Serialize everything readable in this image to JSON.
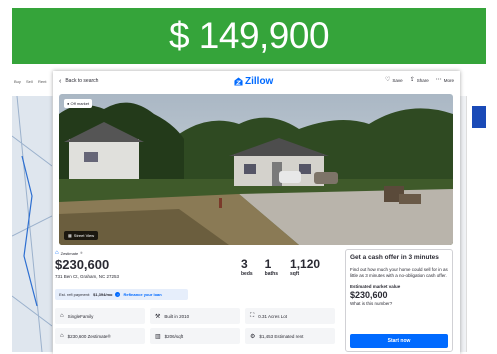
{
  "banner": {
    "price_text": "$ 149,900"
  },
  "colors": {
    "banner_green": "#35a43a",
    "zillow_blue": "#006aff",
    "text_dark": "#2a2a33"
  },
  "topbar": {
    "back_label": "Back to search",
    "logo_text": "Zillow",
    "actions": [
      {
        "label": "Save",
        "icon": "heart-icon"
      },
      {
        "label": "Share",
        "icon": "share-icon"
      },
      {
        "label": "More",
        "icon": "more-icon"
      }
    ]
  },
  "photo": {
    "badge": "Off market",
    "street_view_label": "Street View"
  },
  "listing": {
    "zestimate_label": "Zestimate",
    "price": "$230,600",
    "address": "731 Ben Ct, Graham, NC 27253",
    "beds_value": "3",
    "beds_label": "beds",
    "baths_value": "1",
    "baths_label": "baths",
    "sqft_value": "1,120",
    "sqft_label": "sqft",
    "refi_prefix": "Est. refi payment:",
    "refi_amount": "$1,394/mo",
    "refi_link": "Refinance your loan"
  },
  "facts": [
    {
      "icon": "home-icon",
      "text": "SingleFamily"
    },
    {
      "icon": "hammer-icon",
      "text": "Built in 2010"
    },
    {
      "icon": "lot-icon",
      "text": "0.31 Acres Lot"
    },
    {
      "icon": "zestimate-icon",
      "text": "$230,600 Zestimate®"
    },
    {
      "icon": "ruler-icon",
      "text": "$206/sqft"
    },
    {
      "icon": "rent-icon",
      "text": "$1,453 Estimated rent"
    }
  ],
  "offer": {
    "title": "Get a cash offer in 3 minutes",
    "body": "Find out how much your home could sell for in as little as 3 minutes with a no-obligation cash offer.",
    "value_label": "Estimated market value",
    "value": "$230,600",
    "question": "What is this number?",
    "button": "Start now"
  },
  "background": {
    "tabs": [
      "Buy",
      "Sell",
      "Rent"
    ]
  }
}
